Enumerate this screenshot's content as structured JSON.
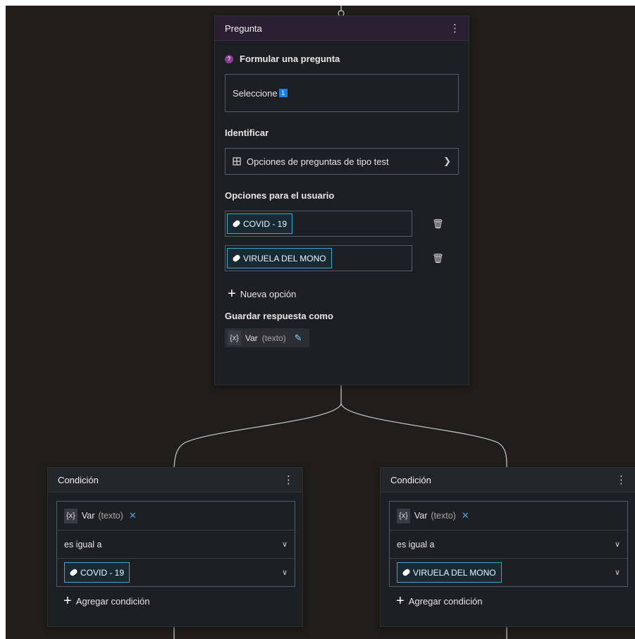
{
  "question": {
    "title": "Pregunta",
    "ask_label": "Formular una pregunta",
    "message_text": "Seleccione",
    "identify_label": "Identificar",
    "identify_value": "Opciones de preguntas de tipo test",
    "options_label": "Opciones para el usuario",
    "options": [
      "COVID - 19",
      "VIRUELA DEL MONO"
    ],
    "new_option_label": "Nueva opción",
    "save_label": "Guardar respuesta como",
    "var_name": "Var",
    "var_type": "(texto)"
  },
  "conditions": [
    {
      "title": "Condición",
      "var_name": "Var",
      "var_type": "(texto)",
      "operator": "es igual a",
      "value": "COVID - 19",
      "add_label": "Agregar condición"
    },
    {
      "title": "Condición",
      "var_name": "Var",
      "var_type": "(texto)",
      "operator": "es igual a",
      "value": "VIRUELA DEL MONO",
      "add_label": "Agregar condición"
    }
  ],
  "icons": {
    "var_badge": "{x}",
    "menu": "⋮",
    "close": "✕"
  },
  "colors": {
    "canvas": "#201d1a",
    "node": "#1c1f23",
    "question_header": "#2a1f33",
    "accent": "#3aa8d0"
  }
}
